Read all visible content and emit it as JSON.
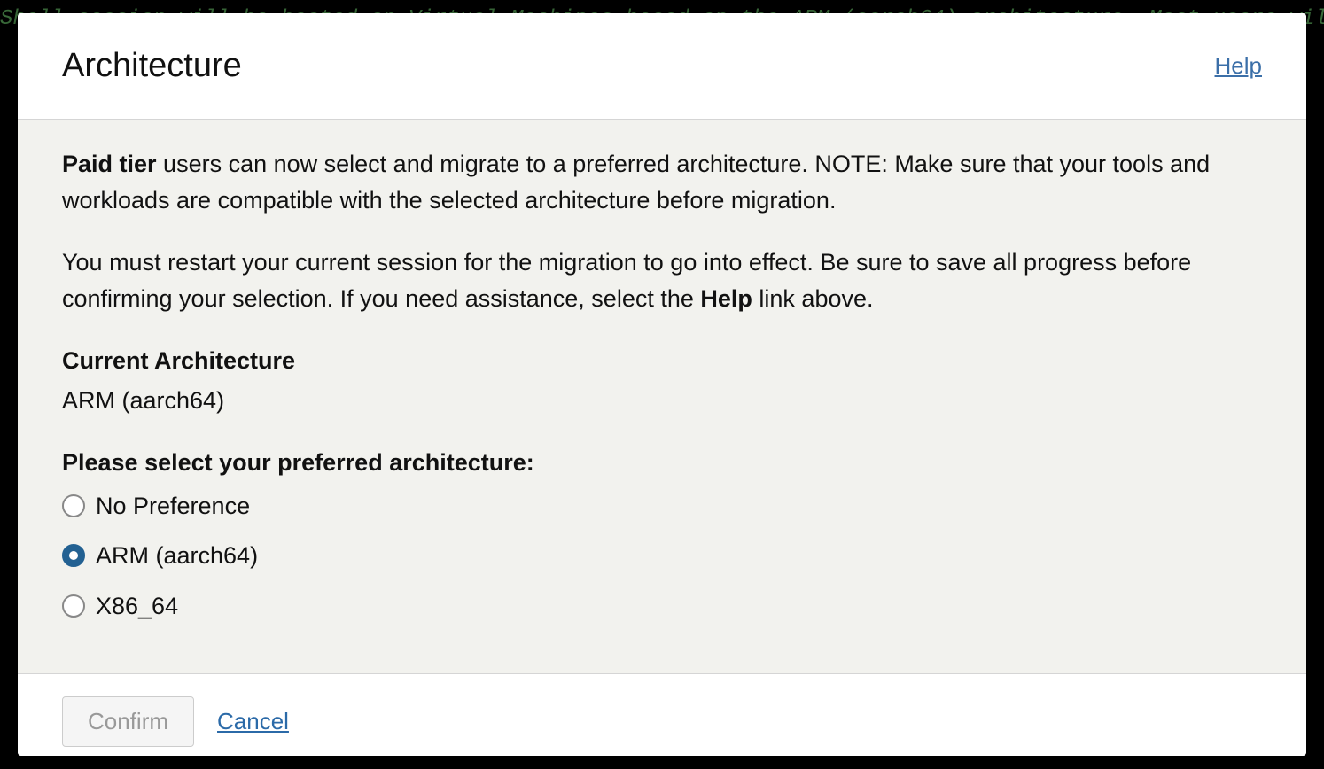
{
  "terminal_bg_text": "Shell session will be hosted on Virtual Machines based on the ARM (aarch64) architecture. Most users will b",
  "header": {
    "title": "Architecture",
    "help_label": "Help"
  },
  "body": {
    "p1_bold": "Paid tier",
    "p1_rest": " users can now select and migrate to a preferred architecture. NOTE: Make sure that your tools and workloads are compatible with the selected architecture before migration.",
    "p2_before": "You must restart your current session for the migration to go into effect. Be sure to save all progress before confirming your selection. If you need assistance, select the ",
    "p2_bold": "Help",
    "p2_after": " link above.",
    "current_label": "Current Architecture",
    "current_value": "ARM (aarch64)",
    "select_label": "Please select your preferred architecture:",
    "options": [
      {
        "label": "No Preference",
        "selected": false
      },
      {
        "label": "ARM (aarch64)",
        "selected": true
      },
      {
        "label": "X86_64",
        "selected": false
      }
    ]
  },
  "footer": {
    "confirm_label": "Confirm",
    "cancel_label": "Cancel"
  }
}
